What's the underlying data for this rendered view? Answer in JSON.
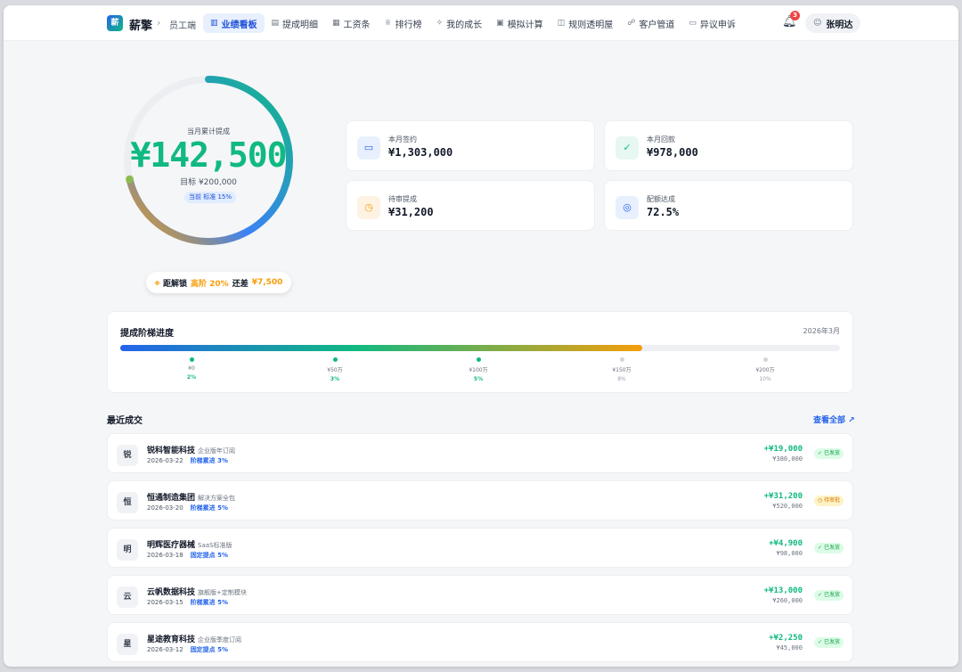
{
  "header": {
    "logo": "薪",
    "brand": "薪擎",
    "breadcrumb_sep": "›",
    "breadcrumb": "员工端",
    "nav": [
      {
        "label": "业绩看板",
        "icon": "bar-chart-icon",
        "glyph": "▥",
        "active": true
      },
      {
        "label": "提成明细",
        "icon": "document-icon",
        "glyph": "▤",
        "active": false
      },
      {
        "label": "工资条",
        "icon": "payslip-icon",
        "glyph": "▦",
        "active": false
      },
      {
        "label": "排行榜",
        "icon": "trophy-icon",
        "glyph": "♕",
        "active": false
      },
      {
        "label": "我的成长",
        "icon": "sparkle-icon",
        "glyph": "✧",
        "active": false
      },
      {
        "label": "模拟计算",
        "icon": "calculator-icon",
        "glyph": "▣",
        "active": false
      },
      {
        "label": "规则透明屋",
        "icon": "book-icon",
        "glyph": "◫",
        "active": false
      },
      {
        "label": "客户管道",
        "icon": "users-icon",
        "glyph": "☍",
        "active": false
      },
      {
        "label": "异议申诉",
        "icon": "message-icon",
        "glyph": "▭",
        "active": false
      }
    ],
    "notification_count": "3",
    "user_name": "张明达"
  },
  "summary": {
    "label": "当月累计提成",
    "value": "¥142,500",
    "target": "目标 ¥200,000",
    "current_tier": "当前 标准 15%",
    "progress_fraction": 0.7125
  },
  "unlock": {
    "prefix": "距解锁",
    "tier": "高阶 20%",
    "middle": "还差",
    "gap": "¥7,500"
  },
  "stats": [
    {
      "label": "本月签约",
      "value": "¥1,303,000",
      "icon": "cash-icon",
      "glyph": "▭",
      "color": "#2563eb",
      "bg": "#e8f0fe"
    },
    {
      "label": "本月回款",
      "value": "¥978,000",
      "icon": "check-circle-icon",
      "glyph": "✓",
      "color": "#10b981",
      "bg": "#e6f8f1"
    },
    {
      "label": "待审提成",
      "value": "¥31,200",
      "icon": "clock-icon",
      "glyph": "◷",
      "color": "#f59e0b",
      "bg": "#fef3e2"
    },
    {
      "label": "配额达成",
      "value": "72.5%",
      "icon": "target-icon",
      "glyph": "◎",
      "color": "#2563eb",
      "bg": "#e8f0fe"
    }
  ],
  "ladder": {
    "title": "提成阶梯进度",
    "date": "2026年3月",
    "progress_fraction": 0.725,
    "ticks": [
      {
        "amount": "¥0",
        "rate": "2%",
        "reached": true
      },
      {
        "amount": "¥50万",
        "rate": "3%",
        "reached": true
      },
      {
        "amount": "¥100万",
        "rate": "5%",
        "reached": true
      },
      {
        "amount": "¥150万",
        "rate": "8%",
        "reached": false
      },
      {
        "amount": "¥200万",
        "rate": "10%",
        "reached": false
      }
    ]
  },
  "recent": {
    "title": "最近成交",
    "view_all": "查看全部 ↗",
    "deals": [
      {
        "avatar": "锐",
        "name": "锐科智能科技",
        "plan": "企业版年订阅",
        "date": "2026-03-22",
        "rule": "阶梯累进 3%",
        "commission": "+¥19,000",
        "amount": "¥380,000",
        "status": "已发放",
        "status_type": "paid"
      },
      {
        "avatar": "恒",
        "name": "恒通制造集团",
        "plan": "解决方案全包",
        "date": "2026-03-20",
        "rule": "阶梯累进 5%",
        "commission": "+¥31,200",
        "amount": "¥520,000",
        "status": "待审批",
        "status_type": "pend"
      },
      {
        "avatar": "明",
        "name": "明辉医疗器械",
        "plan": "SaaS标准版",
        "date": "2026-03-18",
        "rule": "固定提点 5%",
        "commission": "+¥4,900",
        "amount": "¥98,000",
        "status": "已发放",
        "status_type": "paid"
      },
      {
        "avatar": "云",
        "name": "云帆数据科技",
        "plan": "旗舰版+定制模块",
        "date": "2026-03-15",
        "rule": "阶梯累进 5%",
        "commission": "+¥13,000",
        "amount": "¥260,000",
        "status": "已发放",
        "status_type": "paid"
      },
      {
        "avatar": "星",
        "name": "星途教育科技",
        "plan": "企业版季度订阅",
        "date": "2026-03-12",
        "rule": "固定提点 5%",
        "commission": "+¥2,250",
        "amount": "¥45,000",
        "status": "已发放",
        "status_type": "paid"
      }
    ]
  }
}
